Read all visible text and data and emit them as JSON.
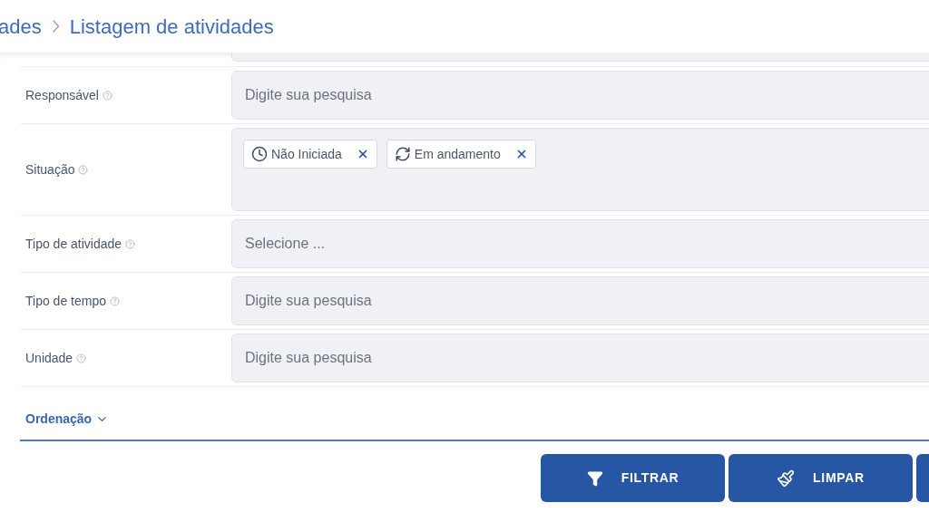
{
  "breadcrumb": {
    "parent": "ades",
    "current": "Listagem de atividades"
  },
  "filters": [
    {
      "label": "Responsável",
      "kind": "search",
      "placeholder": "Digite sua pesquisa"
    },
    {
      "label": "Situação",
      "kind": "tags",
      "tags": [
        {
          "label": "Não Iniciada",
          "kind": "clock"
        },
        {
          "label": "Em andamento",
          "kind": "refresh"
        }
      ]
    },
    {
      "label": "Tipo de atividade",
      "kind": "select",
      "placeholder": "Selecione ..."
    },
    {
      "label": "Tipo de tempo",
      "kind": "search",
      "placeholder": "Digite sua pesquisa"
    },
    {
      "label": "Unidade",
      "kind": "search",
      "placeholder": "Digite sua pesquisa"
    }
  ],
  "sorting": {
    "label": "Ordenação",
    "expanded": false
  },
  "buttons": [
    {
      "label": "FILTRAR",
      "kind": "filter"
    },
    {
      "label": "LIMPAR",
      "kind": "clear"
    }
  ]
}
